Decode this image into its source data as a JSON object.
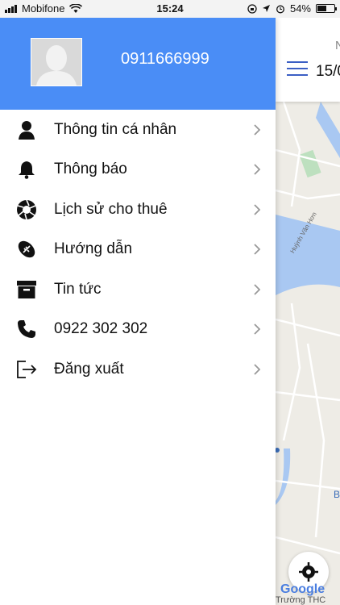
{
  "status_bar": {
    "carrier": "Mobifone",
    "time": "15:24",
    "battery": "54%",
    "battery_level": 0.54
  },
  "drawer": {
    "phone_title": "0911666999",
    "items": [
      {
        "label": "Thông tin cá nhân",
        "icon": "person-icon"
      },
      {
        "label": "Thông báo",
        "icon": "bell-icon"
      },
      {
        "label": "Lịch sử cho thuê",
        "icon": "aperture-icon"
      },
      {
        "label": "Hướng dẫn",
        "icon": "football-icon"
      },
      {
        "label": "Tin tức",
        "icon": "archive-icon"
      },
      {
        "label": "0922 302 302",
        "icon": "phone-icon"
      },
      {
        "label": "Đăng xuất",
        "icon": "logout-icon"
      }
    ]
  },
  "map_header": {
    "top_text": "N",
    "date": "15/0"
  },
  "map": {
    "street_label": "Huỳnh Văn Hơn",
    "letter": "B",
    "logo": "Google",
    "bottom_text": "Trường THC"
  },
  "colors": {
    "drawer_header": "#4a8df6",
    "menu_accent": "#3b5fc4"
  }
}
